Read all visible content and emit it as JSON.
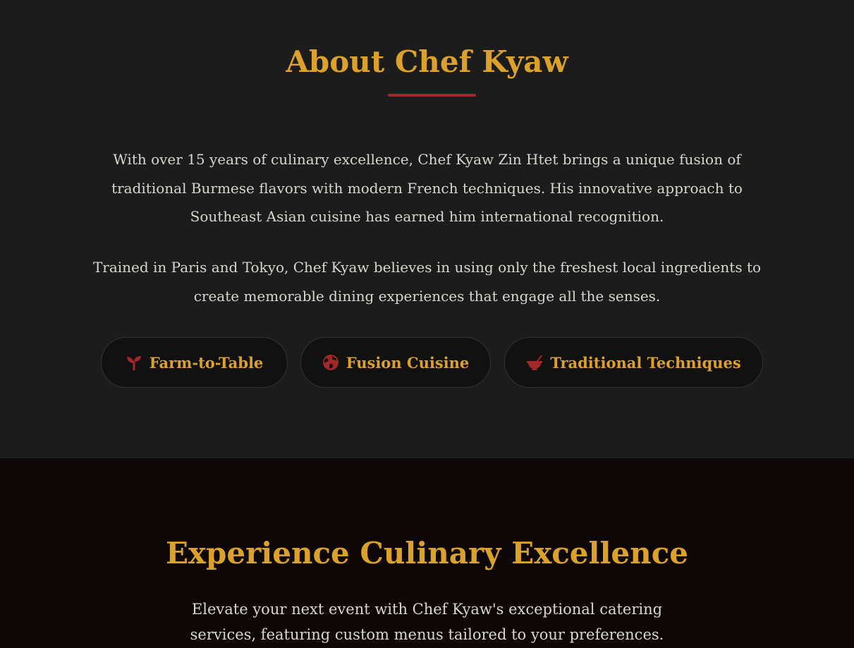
{
  "about": {
    "title": "About Chef Kyaw",
    "paragraph_1": "With over 15 years of culinary excellence, Chef Kyaw Zin Htet brings a unique fusion of traditional Burmese flavors with modern French techniques. His innovative approach to Southeast Asian cuisine has earned him international recognition.",
    "paragraph_2": "Trained in Paris and Tokyo, Chef Kyaw believes in using only the freshest local ingredients to create memorable dining experiences that engage all the senses.",
    "tags": [
      {
        "label": "Farm-to-Table",
        "icon": "seedling-icon"
      },
      {
        "label": "Fusion Cuisine",
        "icon": "globe-icon"
      },
      {
        "label": "Traditional Techniques",
        "icon": "mortar-pestle-icon"
      }
    ]
  },
  "experience": {
    "title": "Experience Culinary Excellence",
    "text": "Elevate your next event with Chef Kyaw's exceptional catering services, featuring custom menus tailored to your preferences."
  },
  "colors": {
    "gold": "#dca12a",
    "red": "#a3282a",
    "text": "#d9d6d0",
    "about_bg": "#1c1c1d",
    "experience_bg": "#0d0807"
  }
}
